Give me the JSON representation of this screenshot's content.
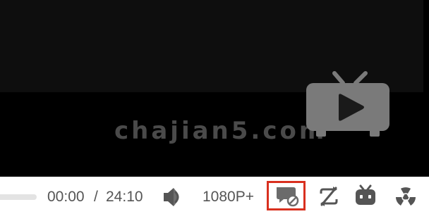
{
  "video": {
    "watermark": "chajian5.com"
  },
  "controls": {
    "current_time": "00:00",
    "time_separator": "/",
    "duration": "24:10",
    "quality": "1080P+"
  },
  "icons": {
    "watermark_logo": "tv-play-icon",
    "volume": "volume-icon",
    "danmaku_toggle": "danmaku-off-icon",
    "loop": "loop-off-icon",
    "bilibili": "bilibili-tv-icon",
    "radiation": "radiation-icon"
  },
  "colors": {
    "highlight": "#d9301f",
    "text": "#555555",
    "video_bg": "#000000"
  }
}
